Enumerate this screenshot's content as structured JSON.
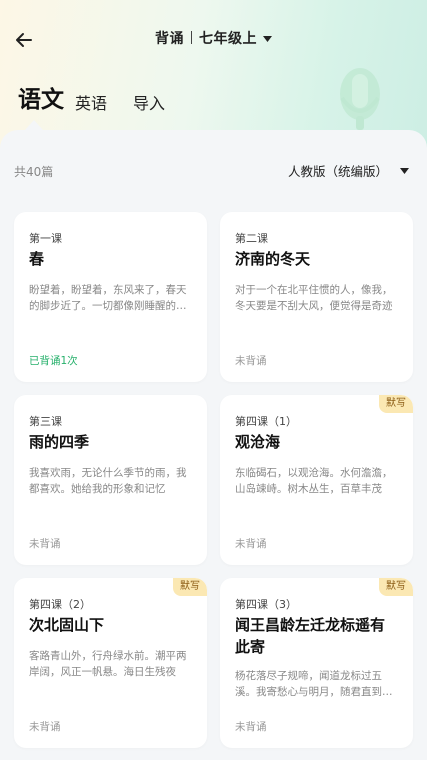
{
  "header": {
    "mode": "背诵",
    "grade": "七年级上"
  },
  "subjects": [
    {
      "label": "语文"
    },
    {
      "label": "英语"
    },
    {
      "label": "导入"
    }
  ],
  "summary": {
    "count": "共40篇",
    "edition": "人教版（统编版）"
  },
  "cards": [
    {
      "lesson": "第一课",
      "title": "春",
      "excerpt": "盼望着，盼望着，东风来了，春天的脚步近了。一切都像刚睡醒的样子",
      "status": "已背诵1次",
      "badge": ""
    },
    {
      "lesson": "第二课",
      "title": "济南的冬天",
      "excerpt": "对于一个在北平住惯的人，像我，冬天要是不刮大风，便觉得是奇迹",
      "status": "未背诵",
      "badge": ""
    },
    {
      "lesson": "第三课",
      "title": "雨的四季",
      "excerpt": "我喜欢雨，无论什么季节的雨，我都喜欢。她给我的形象和记忆",
      "status": "未背诵",
      "badge": ""
    },
    {
      "lesson": "第四课（1）",
      "title": "观沧海",
      "excerpt": "东临碣石，以观沧海。水何澹澹，山岛竦峙。树木丛生，百草丰茂",
      "status": "未背诵",
      "badge": "默写"
    },
    {
      "lesson": "第四课（2）",
      "title": "次北固山下",
      "excerpt": "客路青山外，行舟绿水前。潮平两岸阔，风正一帆悬。海日生残夜",
      "status": "未背诵",
      "badge": "默写"
    },
    {
      "lesson": "第四课（3）",
      "title": "闻王昌龄左迁龙标遥有此寄",
      "excerpt": "杨花落尽子规啼，闻道龙标过五溪。我寄愁心与明月，随君直到夜郎西",
      "status": "未背诵",
      "badge": "默写"
    }
  ]
}
